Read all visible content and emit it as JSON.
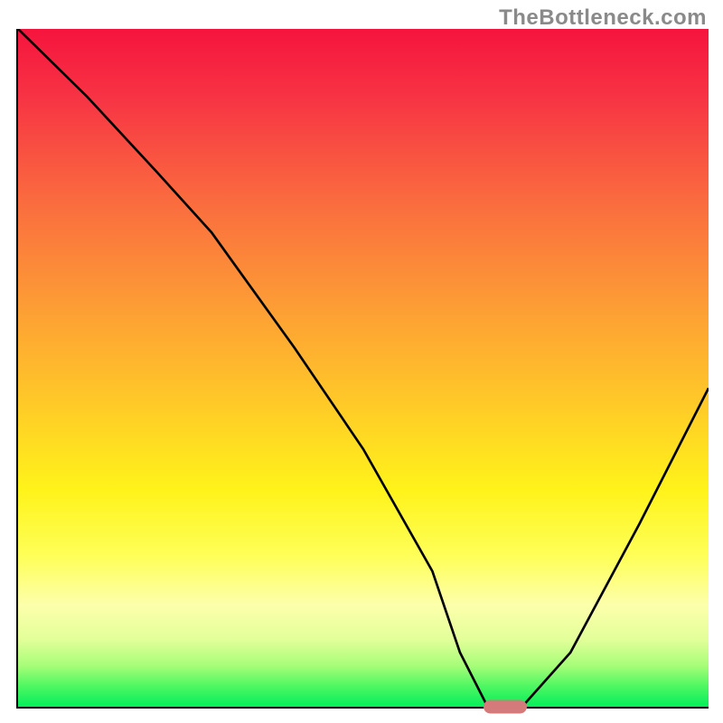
{
  "watermark": "TheBottleneck.com",
  "chart_data": {
    "type": "line",
    "title": "",
    "xlabel": "",
    "ylabel": "",
    "xlim": [
      0,
      100
    ],
    "ylim": [
      0,
      100
    ],
    "series": [
      {
        "name": "curve",
        "x": [
          0,
          10,
          20,
          28,
          40,
          50,
          60,
          64,
          68,
          73,
          80,
          90,
          100
        ],
        "y": [
          100,
          90,
          79,
          70,
          53,
          38,
          20,
          8,
          0,
          0,
          8,
          27,
          47
        ]
      }
    ],
    "marker": {
      "x": 70.5,
      "y": 0
    },
    "gradient_meaning": "top_red_bad_bottom_green_good"
  }
}
